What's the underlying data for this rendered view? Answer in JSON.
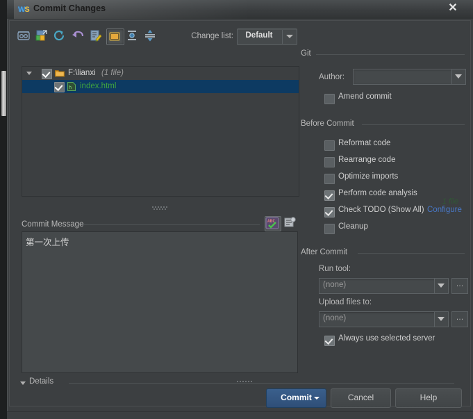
{
  "window": {
    "title": "Commit Changes",
    "logo": "webstorm-logo",
    "close_label": "✕"
  },
  "toolbar": {
    "icons": [
      {
        "name": "show-diff-icon",
        "tip": "Show Diff"
      },
      {
        "name": "revert-icon",
        "tip": "Revert"
      },
      {
        "name": "refresh-icon",
        "tip": "Refresh"
      },
      {
        "name": "rollback-icon",
        "tip": "Rollback"
      },
      {
        "name": "edit-source-icon",
        "tip": "Edit Source"
      },
      {
        "name": "group-by-directory-icon",
        "tip": "Group By Directory"
      },
      {
        "name": "expand-all-icon",
        "tip": "Expand All"
      },
      {
        "name": "collapse-all-icon",
        "tip": "Collapse All"
      }
    ],
    "changelist_label": "Change list:",
    "changelist_value": "Default"
  },
  "file_tree": {
    "rows": [
      {
        "name": "tree-row-folder",
        "label": "F:\\lianxi",
        "sub": "(1 file)",
        "checked": true,
        "expanded": true,
        "selected": false,
        "icon": "folder-icon",
        "level": 0
      },
      {
        "name": "tree-row-file",
        "label": "index.html",
        "sub": "",
        "checked": true,
        "expanded": false,
        "selected": true,
        "icon": "html-file-icon",
        "level": 1
      }
    ],
    "count_hint": "1 file"
  },
  "commit_message": {
    "label": "Commit Message",
    "label_mnemonic": "C",
    "value": "第一次上传",
    "placeholder": "",
    "spellcheck_icon": "spellcheck-abc-icon",
    "history_icon": "message-history-icon"
  },
  "details": {
    "label": "Details",
    "expanded": false
  },
  "git_group": {
    "title": "Git",
    "author_label": "Author:",
    "author_mnemonic": "A",
    "author_value": "",
    "amend_commit": {
      "label": "Amend commit",
      "mnemonic": "m",
      "checked": false
    }
  },
  "before_commit": {
    "title": "Before Commit",
    "items": [
      {
        "name": "reformat-code",
        "label": "Reformat code",
        "mnemonic": "R",
        "checked": false
      },
      {
        "name": "rearrange-code",
        "label": "Rearrange code",
        "mnemonic": "n",
        "checked": false
      },
      {
        "name": "optimize-imports",
        "label": "Optimize imports",
        "mnemonic": "O",
        "checked": false
      },
      {
        "name": "perform-code-analysis",
        "label": "Perform code analysis",
        "mnemonic": "y",
        "checked": true
      },
      {
        "name": "check-todo",
        "label": "Check TODO (Show All)",
        "mnemonic": "",
        "checked": true,
        "link": "Configure"
      },
      {
        "name": "cleanup",
        "label": "Cleanup",
        "mnemonic": "C",
        "checked": false
      }
    ]
  },
  "after_commit": {
    "title": "After Commit",
    "run_tool_label": "Run tool:",
    "run_tool_value": "(none)",
    "upload_files_label": "Upload files to:",
    "upload_files_value": "(none)",
    "always_use_selected_server": {
      "label": "Always use selected server",
      "checked": true
    },
    "browse_label": "…"
  },
  "buttons": {
    "commit": "Commit",
    "cancel": "Cancel",
    "help": "Help"
  },
  "colors": {
    "accent_blue": "#3a5f8c",
    "selection_blue": "#0d3a62",
    "link_blue": "#4878c8",
    "file_green": "#3fa33f",
    "panel_bg": "#3c3f41",
    "field_bg": "#45494b"
  }
}
